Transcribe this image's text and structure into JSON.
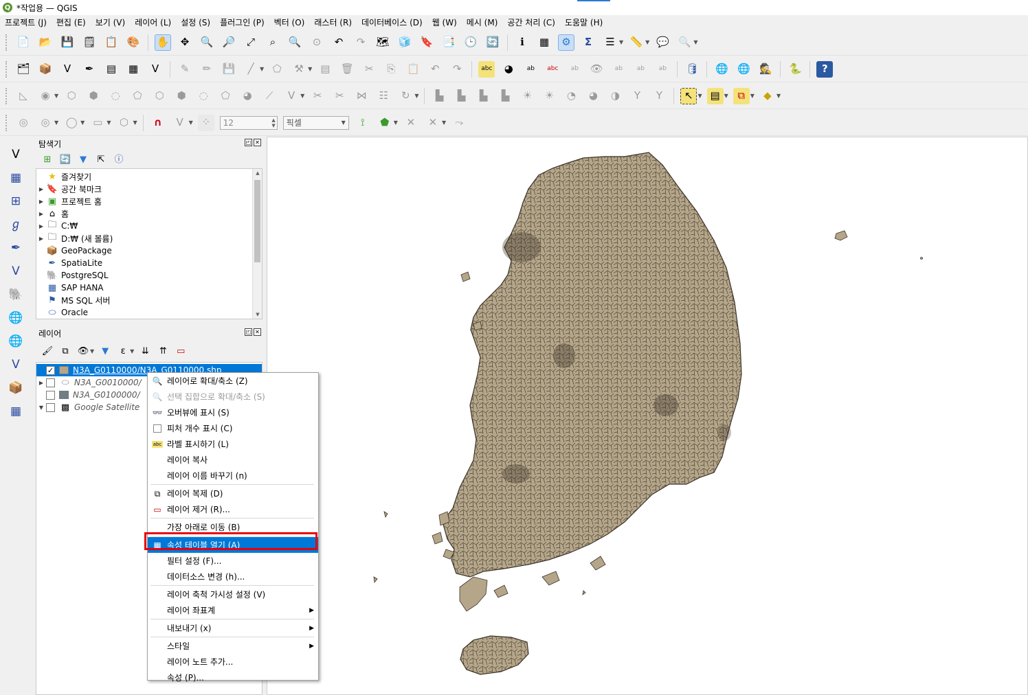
{
  "window": {
    "title": "*작업용 — QGIS",
    "logo": "Q"
  },
  "menu": [
    "프로젝트 (J)",
    "편집 (E)",
    "보기 (V)",
    "레이어 (L)",
    "설정 (S)",
    "플러그인 (P)",
    "벡터 (O)",
    "래스터 (R)",
    "데이터베이스 (D)",
    "웹 (W)",
    "메시 (M)",
    "공간 처리 (C)",
    "도움말 (H)"
  ],
  "toolbar4": {
    "snap_tolerance": "12",
    "snap_units": "픽셀"
  },
  "browser": {
    "title": "탐색기",
    "items": [
      {
        "label": "즐겨찾기",
        "icon": "star-icon"
      },
      {
        "label": "공간 북마크",
        "icon": "bookmark-icon"
      },
      {
        "label": "프로젝트 홈",
        "icon": "project-home-icon"
      },
      {
        "label": "홈",
        "icon": "home-icon"
      },
      {
        "label": "C:₩",
        "icon": "folder-icon"
      },
      {
        "label": "D:₩ (새 볼륨)",
        "icon": "folder-icon"
      },
      {
        "label": "GeoPackage",
        "icon": "geopackage-icon"
      },
      {
        "label": "SpatiaLite",
        "icon": "spatialite-icon"
      },
      {
        "label": "PostgreSQL",
        "icon": "postgresql-icon"
      },
      {
        "label": "SAP HANA",
        "icon": "saphana-icon"
      },
      {
        "label": "MS SQL 서버",
        "icon": "mssql-icon"
      },
      {
        "label": "Oracle",
        "icon": "oracle-icon"
      }
    ]
  },
  "layers": {
    "title": "레이어",
    "items": [
      {
        "label": "N3A_G0110000/N3A_G0110000.shp",
        "checked": "✓",
        "color": "#b5a68a"
      },
      {
        "label": "N3A_G0010000/",
        "checked": "",
        "color": "#e8e8e8"
      },
      {
        "label": "N3A_G0100000/",
        "checked": "",
        "color": "#6f7f88"
      },
      {
        "label": "Google Satellite",
        "checked": "",
        "color": ""
      }
    ]
  },
  "context_menu": {
    "items": [
      {
        "label": "레이어로 확대/축소 (Z)",
        "icon": "zoom-icon",
        "state": "normal"
      },
      {
        "label": "선택 집합으로 확대/축소 (S)",
        "icon": "zoom-selection-icon",
        "state": "disabled"
      },
      {
        "label": "오버뷰에 표시 (S)",
        "icon": "glasses-icon",
        "state": "normal"
      },
      {
        "label": "피처 개수 표시 (C)",
        "icon": "checkbox-icon",
        "state": "normal"
      },
      {
        "label": "라벨 표시하기 (L)",
        "icon": "label-icon",
        "state": "normal"
      },
      {
        "label": "레이어 복사",
        "icon": "",
        "state": "normal"
      },
      {
        "label": "레이어 이름 바꾸기 (n)",
        "icon": "",
        "state": "normal"
      },
      {
        "label": "레이어 복제 (D)",
        "icon": "duplicate-icon",
        "state": "normal"
      },
      {
        "label": "레이어 제거 (R)...",
        "icon": "remove-icon",
        "state": "normal"
      },
      {
        "label": "가장 아래로 이동 (B)",
        "icon": "",
        "state": "normal"
      },
      {
        "label": "속성 테이블 열기 (A)",
        "icon": "table-icon",
        "state": "highlight"
      },
      {
        "label": "필터 설정 (F)...",
        "icon": "",
        "state": "normal"
      },
      {
        "label": "데이터소스 변경 (h)...",
        "icon": "",
        "state": "normal"
      },
      {
        "label": "레이어 축척 가시성 설정 (V)",
        "icon": "",
        "state": "normal"
      },
      {
        "label": "레이어 좌표계",
        "icon": "",
        "state": "submenu"
      },
      {
        "label": "내보내기 (x)",
        "icon": "",
        "state": "submenu"
      },
      {
        "label": "스타일",
        "icon": "",
        "state": "submenu"
      },
      {
        "label": "레이어 노트 추가...",
        "icon": "",
        "state": "normal"
      },
      {
        "label": "속성 (P)...",
        "icon": "",
        "state": "normal"
      }
    ]
  },
  "colors": {
    "accent": "#0078d7",
    "highlight_box": "#e8000b",
    "polygon_fill": "#b5a68a",
    "polygon_stroke": "#3a3226"
  }
}
